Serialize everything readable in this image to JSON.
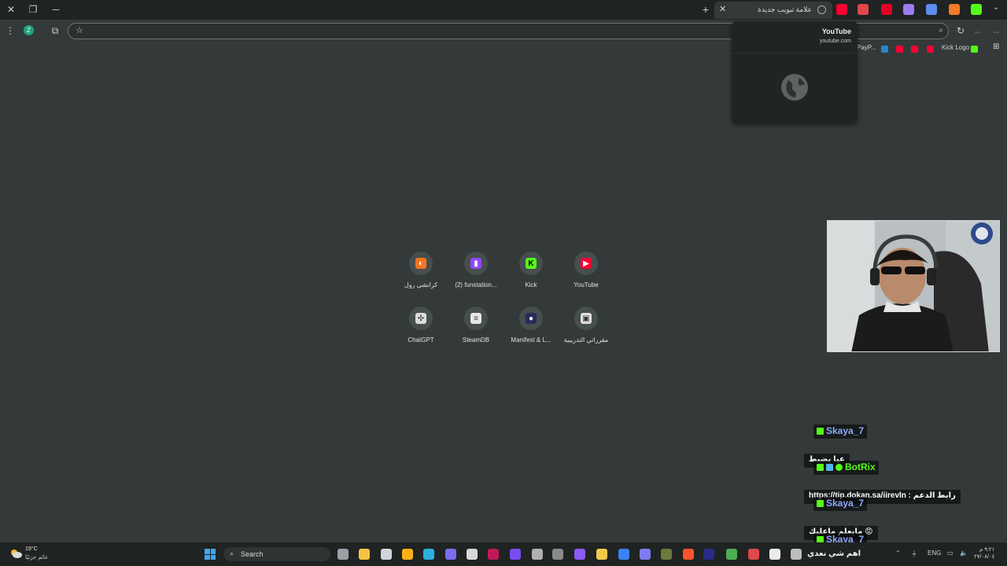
{
  "browser": {
    "active_tab": {
      "title": "علامة تبويب جديدة",
      "close_glyph": "✕",
      "favicon": "globe-icon"
    },
    "new_tab_glyph": "+",
    "pinned_tabs": [
      {
        "name": "youtube-tab",
        "color": "#ff0033"
      },
      {
        "name": "tab-2",
        "color": "#e0474c"
      },
      {
        "name": "pinterest-tab",
        "color": "#e60023"
      },
      {
        "name": "tab-4",
        "color": "#9b7cf0"
      },
      {
        "name": "tab-5",
        "color": "#5b8df0"
      },
      {
        "name": "tab-6",
        "color": "#f27b2a"
      },
      {
        "name": "kick-tab",
        "color": "#53fc18"
      }
    ],
    "omnibox": {
      "value": ""
    },
    "bookmarks": [
      {
        "label": "Kick Logo",
        "favicon_color": "#53fc18"
      },
      {
        "label": "PayP...",
        "favicon_color": "#2b86c9"
      }
    ]
  },
  "hover_card": {
    "title": "YouTube",
    "url": "youtube.com",
    "preview_icon": "globe-icon"
  },
  "shortcuts": [
    {
      "label": "كرانشي رول",
      "icon": "crunchyroll-icon",
      "color": "#f47521",
      "glyph": "◐"
    },
    {
      "label": "(2) funstation...",
      "icon": "twitch-icon",
      "color": "#9146ff",
      "glyph": "▮"
    },
    {
      "label": "Kick",
      "icon": "kick-icon",
      "color": "#53fc18",
      "glyph": "K"
    },
    {
      "label": "YouTube",
      "icon": "youtube-icon",
      "color": "#ff0033",
      "glyph": "▶"
    },
    {
      "label": "ChatGPT",
      "icon": "chatgpt-icon",
      "color": "#dcdcdc",
      "glyph": "✣"
    },
    {
      "label": "SteamDB",
      "icon": "steamdb-icon",
      "color": "#e8e8e8",
      "glyph": "≡"
    },
    {
      "label": "Manifest & L...",
      "icon": "manifest-icon",
      "color": "#2a2a5a",
      "glyph": "●"
    },
    {
      "label": "مقرراتي التدريبية",
      "icon": "courses-icon",
      "color": "#e0e0e0",
      "glyph": "▣"
    }
  ],
  "chat": [
    {
      "user": "Skaya_7",
      "user_color": "#8fa9ff",
      "text": "عيا يضبط"
    },
    {
      "user": "BotRix",
      "user_color": "#53fc18",
      "text": "https://tip.dokan.sa/iirevln : رابط الدعم"
    },
    {
      "user": "Skaya_7",
      "user_color": "#8fa9ff",
      "text": "مايعلم ماعليك 😡"
    },
    {
      "user": "Skaya_7",
      "user_color": "#8fa9ff",
      "text": ""
    }
  ],
  "taskbar": {
    "weather_temp": "19°C",
    "weather_desc": "غائم جزئيًا",
    "search_placeholder": "Search",
    "active_window_title": "اهم شي نعدي",
    "language": "ENG",
    "clock_time": "٩:٢١ م",
    "clock_date": "٢٧/٠٨/٠٤"
  }
}
